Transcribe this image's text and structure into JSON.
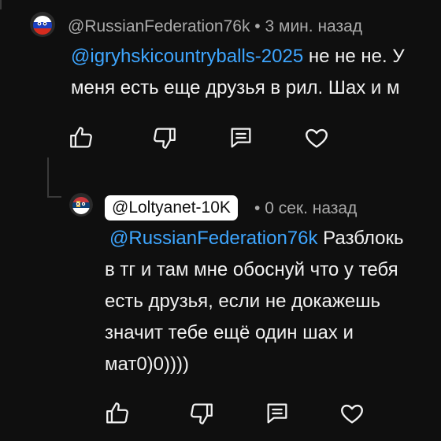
{
  "comment1": {
    "author": "@RussianFederation76k",
    "separator": "•",
    "time": "3 мин. назад",
    "mention": "@igryhskicountryballs-2025",
    "line1_rest": " не не не. У",
    "line2": "меня есть еще друзья в рил. Шах и м"
  },
  "comment2": {
    "author": "@Loltyanet-10K",
    "separator": "•",
    "time": "0 сек. назад",
    "mention": "@RussianFederation76k",
    "line1_rest": " Разблокь",
    "line2": "в тг и там мне обоснуй что у тебя",
    "line3": "есть друзья, если не докажешь",
    "line4": "значит тебе ещё один шах и",
    "line5": "мат0)0))))"
  },
  "icons": [
    "like-icon",
    "dislike-icon",
    "reply-icon",
    "heart-icon"
  ],
  "colors": {
    "background": "#0f0f0f",
    "text": "#f1f1f1",
    "meta": "#aaaaaa",
    "mention": "#3ea6ff",
    "chip": "#ffffff"
  }
}
